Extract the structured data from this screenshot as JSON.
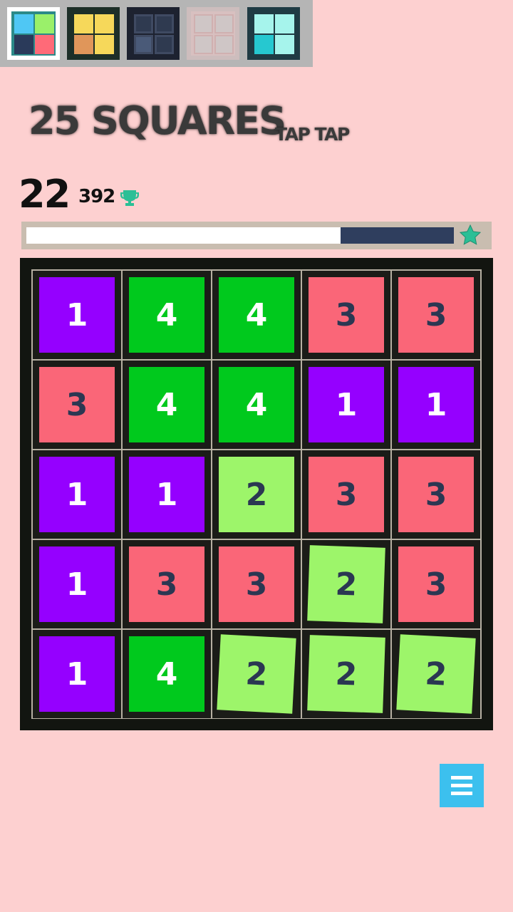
{
  "themes": [
    {
      "name": "theme-multicolor",
      "selected": true,
      "frame": "#ffffff",
      "inner": "#2b8a88",
      "quads": [
        "#4fc7f4",
        "#9af06a",
        "#2a3a5a",
        "#ff6a78"
      ]
    },
    {
      "name": "theme-yellow",
      "selected": false,
      "frame": "#1d2f28",
      "inner": "#1d2f28",
      "quads": [
        "#f6d85a",
        "#f6d85a",
        "#e0965a",
        "#f6d85a"
      ]
    },
    {
      "name": "theme-dark",
      "selected": false,
      "frame": "#1d2230",
      "inner": "#1d2230",
      "quads": [
        "#2f3a50",
        "#2f3a50",
        "#4a5a78",
        "#2f3a50"
      ]
    },
    {
      "name": "theme-faded",
      "selected": false,
      "frame": "#c8a8a8",
      "inner": "#d8c0c0",
      "quads": [
        "#cfc6c6",
        "#cfc6c6",
        "#cfc6c6",
        "#cfc6c6"
      ]
    },
    {
      "name": "theme-cyan",
      "selected": false,
      "frame": "#1f3b44",
      "inner": "#1f3b44",
      "quads": [
        "#a6f4ec",
        "#a6f4ec",
        "#26c8d0",
        "#a6f4ec"
      ]
    }
  ],
  "title": "25 SQUARES",
  "subtitle": "TAP TAP",
  "score": {
    "moves": "22",
    "best": "392"
  },
  "progress": {
    "fraction": 0.735
  },
  "colors": {
    "background": "#fdd0d0",
    "trophy": "#2bbf96",
    "star": "#2bbf96",
    "menu_button": "#3cc0ee",
    "progress_remaining": "#2f3e5e",
    "progress_fill": "#ffffff"
  },
  "palette": {
    "1": {
      "bg": "#9500ff",
      "fg": "#ffffff"
    },
    "2": {
      "bg": "#9df56a",
      "fg": "#2b3752"
    },
    "3": {
      "bg": "#fa6678",
      "fg": "#2b3752"
    },
    "4": {
      "bg": "#00c91d",
      "fg": "#ffffff"
    }
  },
  "board": {
    "rows": [
      [
        1,
        4,
        4,
        3,
        3
      ],
      [
        3,
        4,
        4,
        1,
        1
      ],
      [
        1,
        1,
        2,
        3,
        3
      ],
      [
        1,
        3,
        3,
        2,
        3
      ],
      [
        1,
        4,
        2,
        2,
        2
      ]
    ],
    "tilted": [
      [
        3,
        3
      ],
      [
        4,
        2
      ],
      [
        4,
        3
      ],
      [
        4,
        4
      ]
    ]
  },
  "icons": {
    "trophy": "trophy-icon",
    "star": "star-icon",
    "menu": "hamburger-menu-icon"
  }
}
